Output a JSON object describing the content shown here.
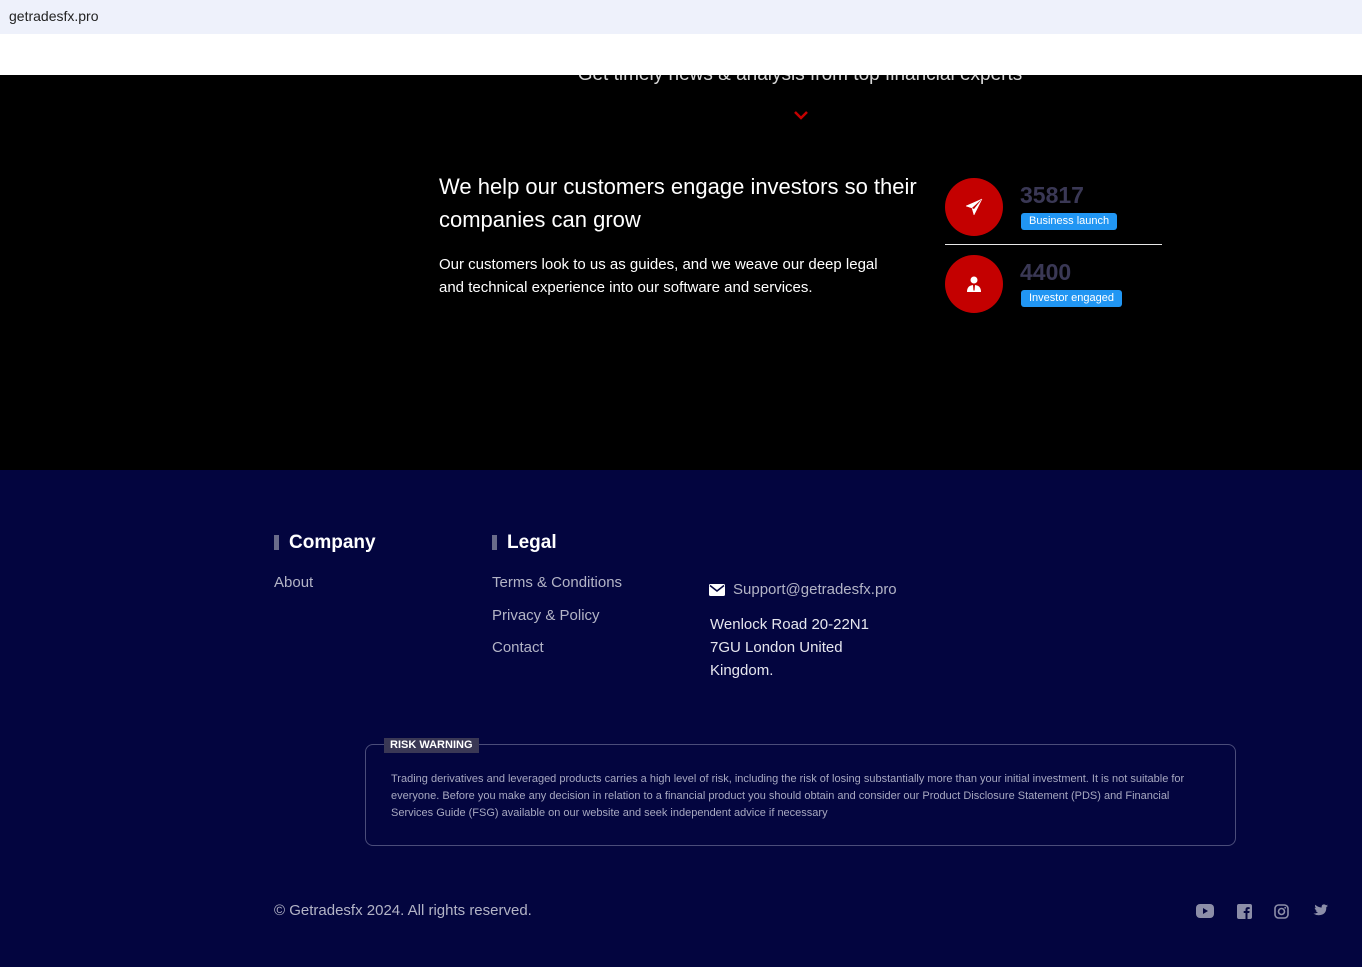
{
  "browser": {
    "url": "getradesfx.pro"
  },
  "hero": {
    "tagline": "Get timely news & analysis from top financial experts",
    "title": "We help our customers engage investors so their companies can grow",
    "text": "Our customers look to us as guides, and we weave our deep legal and technical experience into our software and services.",
    "stats": [
      {
        "value": "35817",
        "label": "Business launch",
        "icon": "paper-plane-icon"
      },
      {
        "value": "4400",
        "label": "Investor engaged",
        "icon": "user-tie-icon"
      }
    ],
    "accent_color": "#c40000",
    "badge_color": "#2196f3"
  },
  "footer": {
    "company": {
      "title": "Company",
      "links": [
        "About"
      ]
    },
    "legal": {
      "title": "Legal",
      "links": [
        "Terms & Conditions",
        "Privacy & Policy",
        "Contact"
      ]
    },
    "contact": {
      "email": "Support@getradesfx.pro",
      "address_lines": [
        "Wenlock Road 20-22N1",
        "7GU London United",
        "Kingdom."
      ]
    },
    "risk": {
      "label": "RISK WARNING",
      "text": "Trading derivatives and leveraged products carries a high level of risk, including the risk of losing substantially more than your initial investment. It is not suitable for everyone. Before you make any decision in relation to a financial product you should obtain and consider our Product Disclosure Statement (PDS) and Financial Services Guide (FSG) available on our website and seek independent advice if necessary"
    },
    "copyright": "© Getradesfx 2024. All rights reserved.",
    "social": [
      "youtube-icon",
      "facebook-icon",
      "instagram-icon",
      "twitter-icon"
    ],
    "background_color": "#03053f"
  }
}
